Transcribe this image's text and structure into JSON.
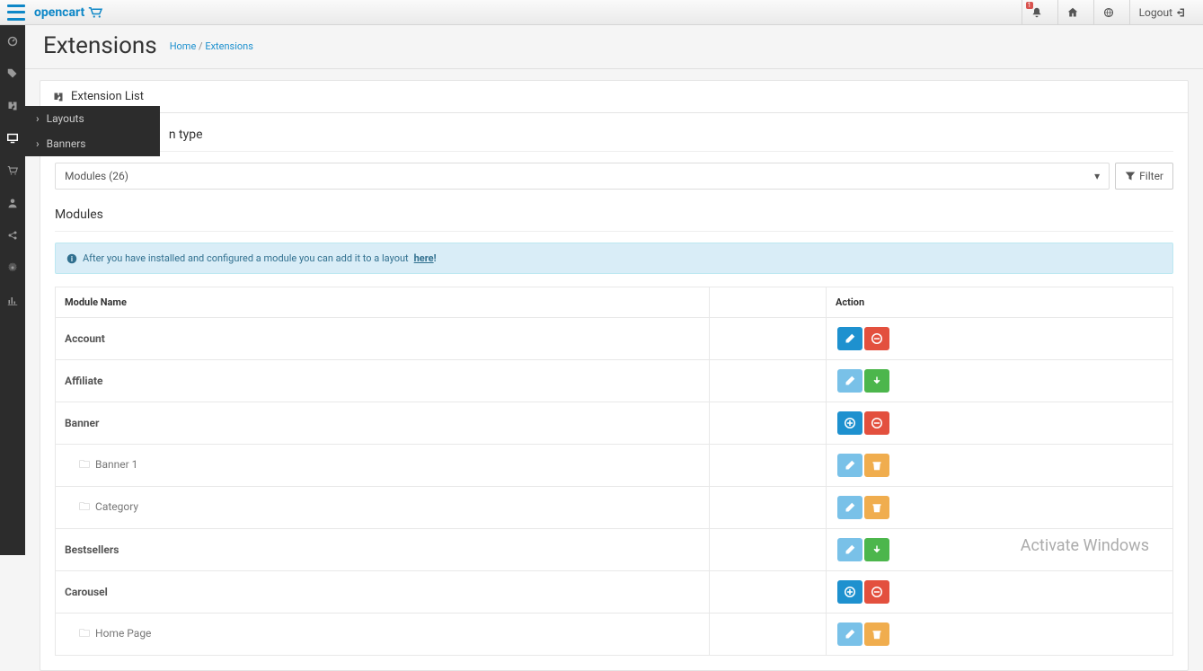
{
  "brand": "opencart",
  "topbar": {
    "logout": "Logout"
  },
  "page": {
    "title": "Extensions",
    "breadcrumb_home": "Home",
    "breadcrumb_current": "Extensions"
  },
  "panel": {
    "header": "Extension List",
    "type_legend_suffix": "n type",
    "select_value": "Modules (26)",
    "filter_label": "Filter",
    "section_title": "Modules",
    "info_text": "After you have installed and configured a module you can add it to a layout ",
    "info_link": "here"
  },
  "flyout": {
    "items": [
      "Layouts",
      "Banners"
    ]
  },
  "table": {
    "col_name": "Module Name",
    "col_action": "Action",
    "rows": [
      {
        "name": "Account",
        "child": false,
        "actions": [
          "edit-blue",
          "remove-red"
        ]
      },
      {
        "name": "Affiliate",
        "child": false,
        "actions": [
          "edit-muted",
          "install-green"
        ]
      },
      {
        "name": "Banner",
        "child": false,
        "actions": [
          "add-blue",
          "remove-red"
        ]
      },
      {
        "name": "Banner 1",
        "child": true,
        "actions": [
          "edit-muted",
          "delete-orange"
        ]
      },
      {
        "name": "Category",
        "child": true,
        "actions": [
          "edit-muted",
          "delete-orange"
        ]
      },
      {
        "name": "Bestsellers",
        "child": false,
        "actions": [
          "edit-muted",
          "install-green"
        ]
      },
      {
        "name": "Carousel",
        "child": false,
        "actions": [
          "add-blue",
          "remove-red"
        ]
      },
      {
        "name": "Home Page",
        "child": true,
        "actions": [
          "edit-muted",
          "delete-orange"
        ]
      }
    ]
  },
  "watermark": "Activate Windows"
}
